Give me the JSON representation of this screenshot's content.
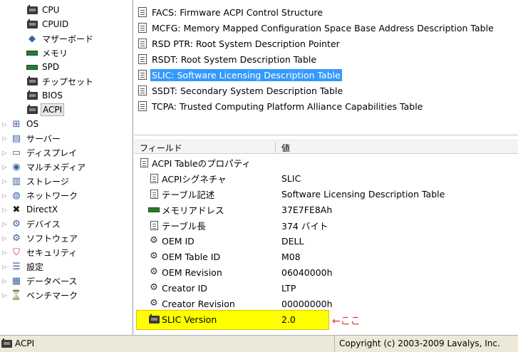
{
  "tree": {
    "items": [
      {
        "label": "CPU",
        "icon": "chip-icon",
        "indent": 2
      },
      {
        "label": "CPUID",
        "icon": "chip-icon",
        "indent": 2
      },
      {
        "label": "マザーボード",
        "icon": "motherboard-icon",
        "indent": 2
      },
      {
        "label": "メモリ",
        "icon": "ram-icon",
        "indent": 2
      },
      {
        "label": "SPD",
        "icon": "ram-icon",
        "indent": 2
      },
      {
        "label": "チップセット",
        "icon": "chip-icon",
        "indent": 2
      },
      {
        "label": "BIOS",
        "icon": "chip-icon",
        "indent": 2
      },
      {
        "label": "ACPI",
        "icon": "chip-icon",
        "indent": 2,
        "selected": true
      },
      {
        "label": "OS",
        "icon": "windows-icon",
        "indent": 1
      },
      {
        "label": "サーバー",
        "icon": "server-icon",
        "indent": 1
      },
      {
        "label": "ディスプレイ",
        "icon": "display-icon",
        "indent": 1
      },
      {
        "label": "マルチメディア",
        "icon": "speaker-icon",
        "indent": 1
      },
      {
        "label": "ストレージ",
        "icon": "storage-icon",
        "indent": 1
      },
      {
        "label": "ネットワーク",
        "icon": "network-icon",
        "indent": 1
      },
      {
        "label": "DirectX",
        "icon": "directx-icon",
        "indent": 1
      },
      {
        "label": "デバイス",
        "icon": "device-icon",
        "indent": 1
      },
      {
        "label": "ソフトウェア",
        "icon": "software-icon",
        "indent": 1
      },
      {
        "label": "セキュリティ",
        "icon": "shield-icon",
        "indent": 1
      },
      {
        "label": "設定",
        "icon": "settings-icon",
        "indent": 1
      },
      {
        "label": "データベース",
        "icon": "database-icon",
        "indent": 1
      },
      {
        "label": "ベンチマーク",
        "icon": "hourglass-icon",
        "indent": 1
      }
    ]
  },
  "tables": {
    "items": [
      {
        "label": "FACS: Firmware ACPI Control Structure"
      },
      {
        "label": "MCFG: Memory Mapped Configuration Space Base Address Description Table"
      },
      {
        "label": "RSD PTR: Root System Description Pointer"
      },
      {
        "label": "RSDT: Root System Description Table"
      },
      {
        "label": "SLIC: Software Licensing Description Table",
        "selected": true
      },
      {
        "label": "SSDT: Secondary System Description Table"
      },
      {
        "label": "TCPA: Trusted Computing Platform Alliance Capabilities Table"
      }
    ]
  },
  "details": {
    "col_field": "フィールド",
    "col_value": "値",
    "group_label": "ACPI Tableのプロパティ",
    "rows": [
      {
        "name": "ACPIシグネチャ",
        "value": "SLIC",
        "icon": "doc-icon"
      },
      {
        "name": "テーブル記述",
        "value": "Software Licensing Description Table",
        "icon": "doc-icon"
      },
      {
        "name": "メモリアドレス",
        "value": "37E7FE8Ah",
        "icon": "ram-icon"
      },
      {
        "name": "テーブル長",
        "value": "374 バイト",
        "icon": "doc-icon"
      },
      {
        "name": "OEM ID",
        "value": "DELL",
        "icon": "gear-icon"
      },
      {
        "name": "OEM Table ID",
        "value": "M08",
        "icon": "gear-icon"
      },
      {
        "name": "OEM Revision",
        "value": "06040000h",
        "icon": "gear-icon"
      },
      {
        "name": "Creator ID",
        "value": "LTP",
        "icon": "gear-icon"
      },
      {
        "name": "Creator Revision",
        "value": "00000000h",
        "icon": "gear-icon"
      },
      {
        "name": "SLIC Version",
        "value": "2.0",
        "icon": "chip-icon"
      }
    ],
    "annotation": "←ここ",
    "highlight_color": "#ffff00",
    "annotation_color": "#e03030"
  },
  "status": {
    "left": "ACPI",
    "right": "Copyright (c) 2003-2009 Lavalys, Inc."
  },
  "colors": {
    "selection": "#3399ff"
  }
}
